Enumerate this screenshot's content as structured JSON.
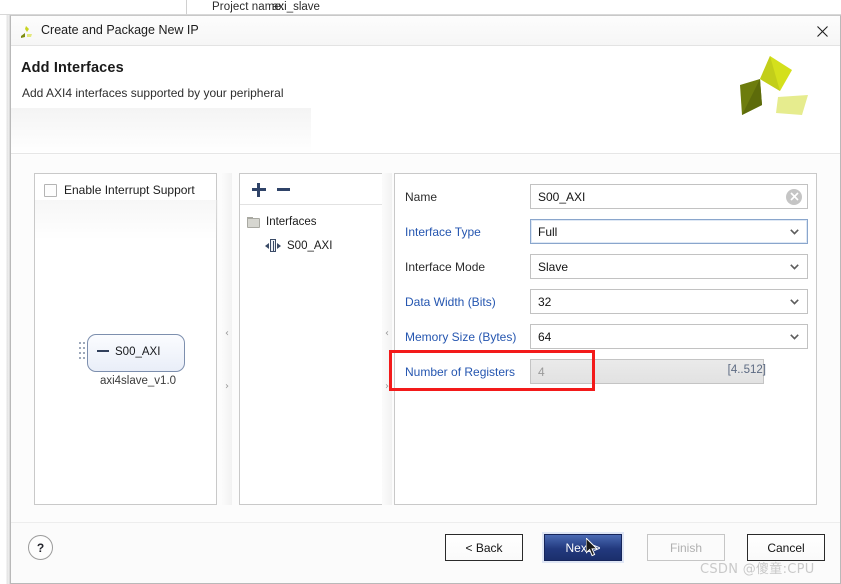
{
  "background": {
    "project_name_label": "Project name:",
    "project_name_value": "axi_slave"
  },
  "titlebar": {
    "title": "Create and Package New IP",
    "app_icon": "vivado-logo-icon",
    "close_icon": "close-icon"
  },
  "header": {
    "title": "Add Interfaces",
    "subtitle": "Add AXI4 interfaces supported by your peripheral",
    "logo_icon": "xilinx-pinwheel-logo"
  },
  "diagram_panel": {
    "interrupt_checkbox_label": "Enable Interrupt Support",
    "interrupt_checked": false,
    "block_port_label": "S00_AXI",
    "block_caption": "axi4slave_v1.0"
  },
  "tree_panel": {
    "add_button_label": "+",
    "remove_button_label": "−",
    "root_label": "Interfaces",
    "child_label": "S00_AXI"
  },
  "form": {
    "rows": [
      {
        "label": "Name",
        "label_style": "plain",
        "value": "S00_AXI",
        "control": "text",
        "state": "normal",
        "trailing_icon": "clear-icon"
      },
      {
        "label": "Interface Type",
        "label_style": "link",
        "value": "Full",
        "control": "dropdown",
        "state": "focused",
        "trailing_icon": "chevron-down-icon"
      },
      {
        "label": "Interface Mode",
        "label_style": "plain",
        "value": "Slave",
        "control": "dropdown",
        "state": "normal",
        "trailing_icon": "chevron-down-icon"
      },
      {
        "label": "Data Width (Bits)",
        "label_style": "link",
        "value": "32",
        "control": "dropdown",
        "state": "normal",
        "trailing_icon": "chevron-down-icon"
      },
      {
        "label": "Memory Size (Bytes)",
        "label_style": "link",
        "value": "64",
        "control": "dropdown",
        "state": "normal",
        "trailing_icon": "chevron-down-icon"
      },
      {
        "label": "Number of Registers",
        "label_style": "link",
        "value": "4",
        "control": "text",
        "state": "disabled",
        "hint": "[4..512]"
      }
    ]
  },
  "splitters": {
    "collapse_left_icon": "chevron-left-icon",
    "expand_right_icon": "chevron-right-icon"
  },
  "footer": {
    "help_label": "?",
    "back_label": "< Back",
    "next_label": "Next >",
    "finish_label": "Finish",
    "cancel_label": "Cancel",
    "next_is_default": true,
    "finish_enabled": false
  },
  "annotation": {
    "highlight_color": "#f31a1a",
    "target": "Interface Type row"
  },
  "watermark": "CSDN @傻童:CPU"
}
